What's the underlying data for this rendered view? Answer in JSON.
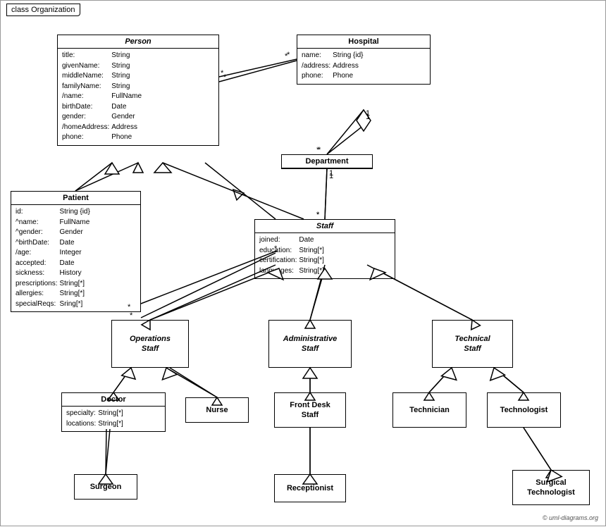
{
  "title": "class Organization",
  "classes": {
    "person": {
      "name": "Person",
      "italic": true,
      "attributes": [
        [
          "title:",
          "String"
        ],
        [
          "givenName:",
          "String"
        ],
        [
          "middleName:",
          "String"
        ],
        [
          "familyName:",
          "String"
        ],
        [
          "/name:",
          "FullName"
        ],
        [
          "birthDate:",
          "Date"
        ],
        [
          "gender:",
          "Gender"
        ],
        [
          "/homeAddress:",
          "Address"
        ],
        [
          "phone:",
          "Phone"
        ]
      ]
    },
    "hospital": {
      "name": "Hospital",
      "italic": false,
      "attributes": [
        [
          "name:",
          "String {id}"
        ],
        [
          "/address:",
          "Address"
        ],
        [
          "phone:",
          "Phone"
        ]
      ]
    },
    "patient": {
      "name": "Patient",
      "italic": false,
      "attributes": [
        [
          "id:",
          "String {id}"
        ],
        [
          "^name:",
          "FullName"
        ],
        [
          "^gender:",
          "Gender"
        ],
        [
          "^birthDate:",
          "Date"
        ],
        [
          "/age:",
          "Integer"
        ],
        [
          "accepted:",
          "Date"
        ],
        [
          "sickness:",
          "History"
        ],
        [
          "prescriptions:",
          "String[*]"
        ],
        [
          "allergies:",
          "String[*]"
        ],
        [
          "specialReqs:",
          "Sring[*]"
        ]
      ]
    },
    "department": {
      "name": "Department",
      "italic": false
    },
    "staff": {
      "name": "Staff",
      "italic": true,
      "attributes": [
        [
          "joined:",
          "Date"
        ],
        [
          "education:",
          "String[*]"
        ],
        [
          "certification:",
          "String[*]"
        ],
        [
          "languages:",
          "String[*]"
        ]
      ]
    },
    "operations_staff": {
      "name": "Operations\nStaff",
      "italic": true
    },
    "administrative_staff": {
      "name": "Administrative\nStaff",
      "italic": true
    },
    "technical_staff": {
      "name": "Technical\nStaff",
      "italic": true
    },
    "doctor": {
      "name": "Doctor",
      "italic": false,
      "attributes": [
        [
          "specialty:",
          "String[*]"
        ],
        [
          "locations:",
          "String[*]"
        ]
      ]
    },
    "nurse": {
      "name": "Nurse",
      "italic": false
    },
    "front_desk_staff": {
      "name": "Front Desk\nStaff",
      "italic": false
    },
    "technician": {
      "name": "Technician",
      "italic": false
    },
    "technologist": {
      "name": "Technologist",
      "italic": false
    },
    "surgeon": {
      "name": "Surgeon",
      "italic": false
    },
    "receptionist": {
      "name": "Receptionist",
      "italic": false
    },
    "surgical_technologist": {
      "name": "Surgical\nTechnologist",
      "italic": false
    }
  },
  "copyright": "© uml-diagrams.org"
}
